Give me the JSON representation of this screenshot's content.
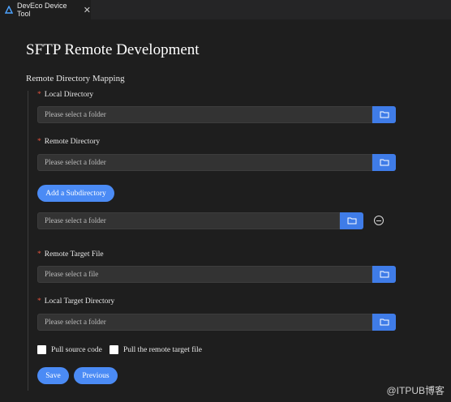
{
  "tab": {
    "title": "DevEco Device Tool",
    "close": "✕",
    "icon": "deveco-logo-icon"
  },
  "page": {
    "title": "SFTP Remote Development"
  },
  "section": {
    "title": "Remote Directory Mapping"
  },
  "required_mark": "*",
  "fields": {
    "local_directory": {
      "label": "Local Directory",
      "placeholder": "Please select a folder"
    },
    "remote_directory": {
      "label": "Remote Directory",
      "placeholder": "Please select a folder"
    },
    "subdirectory": {
      "placeholder": "Please select a folder"
    },
    "remote_target_file": {
      "label": "Remote Target File",
      "placeholder": "Please select a file"
    },
    "local_target_directory": {
      "label": "Local Target Directory",
      "placeholder": "Please select a folder"
    }
  },
  "buttons": {
    "add_subdirectory": "Add a Subdirectory",
    "save": "Save",
    "previous": "Previous"
  },
  "checkboxes": {
    "pull_source_code": {
      "label": "Pull source code",
      "checked": false
    },
    "pull_remote_target_file": {
      "label": "Pull the remote target file",
      "checked": false
    }
  },
  "watermark": "@ITPUB博客",
  "colors": {
    "accent": "#4b8bf5",
    "required": "#e5533d",
    "background": "#1e1e1e"
  }
}
